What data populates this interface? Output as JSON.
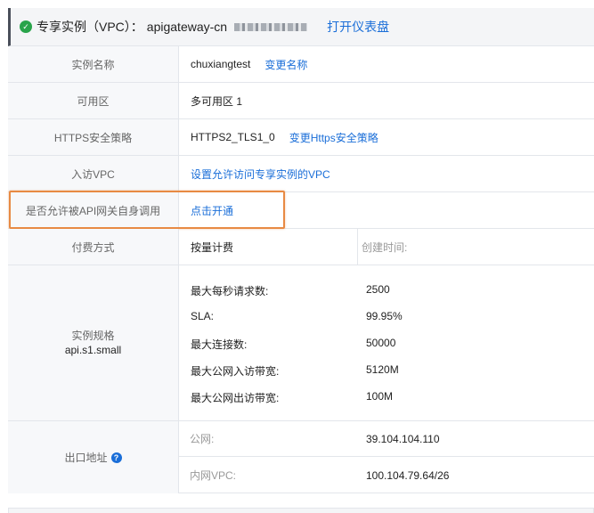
{
  "header": {
    "title": "专享实例（VPC）：",
    "instance_name": "apigateway-cn",
    "dashboard_link": "打开仪表盘",
    "status_color": "#29a44b"
  },
  "rows": {
    "instance_name": {
      "label": "实例名称",
      "value": "chuxiangtest",
      "action": "变更名称"
    },
    "zone": {
      "label": "可用区",
      "value": "多可用区 1"
    },
    "https_policy": {
      "label": "HTTPS安全策略",
      "value": "HTTPS2_TLS1_0",
      "action": "变更Https安全策略"
    },
    "ingress_vpc": {
      "label": "入访VPC",
      "action": "设置允许访问专享实例的VPC"
    },
    "self_invoke": {
      "label": "是否允许被API网关自身调用",
      "action": "点击开通"
    },
    "billing": {
      "label": "付费方式",
      "value": "按量计费",
      "created_label": "创建时间:"
    }
  },
  "spec": {
    "label": "实例规格",
    "type": "api.s1.small",
    "items": [
      {
        "name": "最大每秒请求数:",
        "value": "2500"
      },
      {
        "name": "SLA:",
        "value": "99.95%"
      },
      {
        "name": "最大连接数:",
        "value": "50000"
      },
      {
        "name": "最大公网入访带宽:",
        "value": "5120M"
      },
      {
        "name": "最大公网出访带宽:",
        "value": "100M"
      }
    ]
  },
  "egress": {
    "label": "出口地址",
    "public_label": "公网:",
    "public_value": "39.104.104.110",
    "vpc_label": "内网VPC:",
    "vpc_value": "100.104.79.64/26"
  },
  "colors": {
    "link": "#1a6ed8",
    "highlight": "#e88a43"
  }
}
